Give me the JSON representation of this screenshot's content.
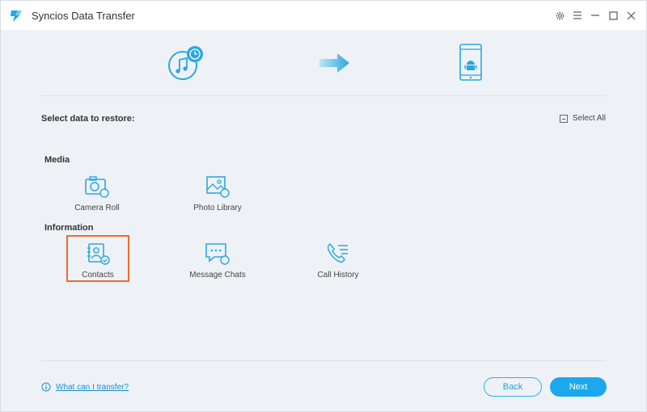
{
  "window": {
    "title": "Syncios Data Transfer"
  },
  "header": {
    "prompt": "Select data to restore:",
    "select_all_label": "Select All"
  },
  "categories": {
    "media": {
      "label": "Media",
      "items": [
        {
          "label": "Camera Roll",
          "icon": "camera-icon"
        },
        {
          "label": "Photo Library",
          "icon": "photo-icon"
        }
      ]
    },
    "information": {
      "label": "Information",
      "items": [
        {
          "label": "Contacts",
          "icon": "contacts-icon",
          "selected": true
        },
        {
          "label": "Message Chats",
          "icon": "message-icon"
        },
        {
          "label": "Call History",
          "icon": "phone-icon"
        }
      ]
    }
  },
  "footer": {
    "help_link": "What can I transfer?",
    "back_label": "Back",
    "next_label": "Next"
  },
  "colors": {
    "accent": "#1ca8ec",
    "selection": "#f06a2e",
    "background": "#eef2f6"
  }
}
